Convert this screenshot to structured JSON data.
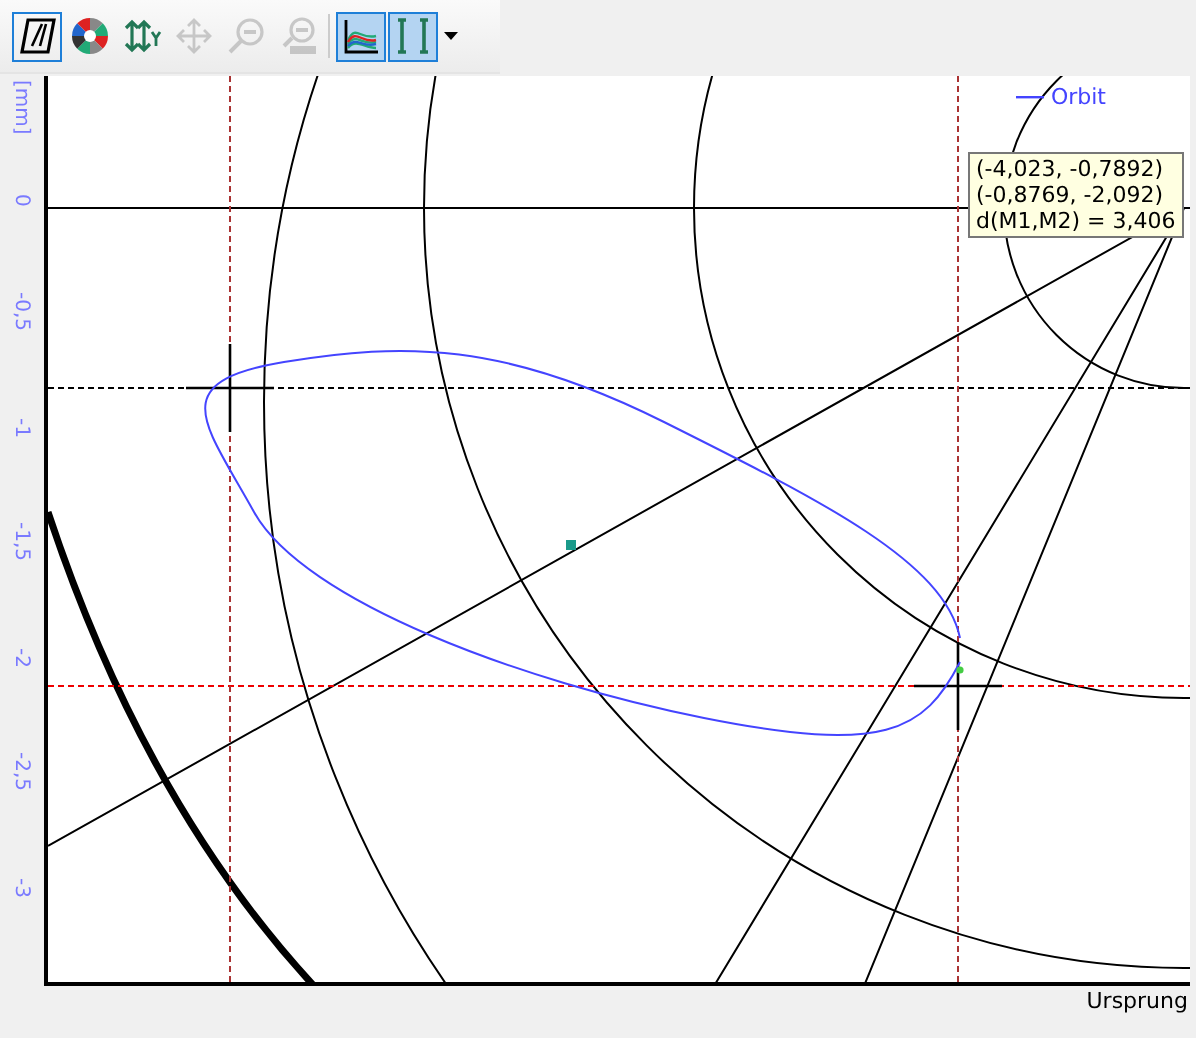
{
  "toolbar": [
    {
      "kind": "diagonal",
      "selected": true,
      "disabled": false
    },
    {
      "kind": "wheel",
      "selected": false,
      "disabled": false
    },
    {
      "kind": "scale-y",
      "selected": false,
      "disabled": false
    },
    {
      "kind": "move",
      "selected": false,
      "disabled": true
    },
    {
      "kind": "zoom-out",
      "selected": false,
      "disabled": true
    },
    {
      "kind": "zoom-all",
      "selected": false,
      "disabled": true
    },
    {
      "kind": "curves",
      "selected": true,
      "disabled": false
    },
    {
      "kind": "cursor",
      "selected": true,
      "disabled": false
    }
  ],
  "plot": {
    "y_unit": "[mm]",
    "y_ticks": [
      "0",
      "-0,5",
      "-1",
      "-1,5",
      "-2",
      "-2,5",
      "-3"
    ],
    "x_label": "Ursprung",
    "legend": [
      {
        "name": "Orbit",
        "color": "#4444ff"
      }
    ],
    "tooltip": [
      "(-4,023,  -0,7892)",
      "(-0,8769,  -2,092)",
      "d(M1,M2) = 3,406"
    ]
  }
}
